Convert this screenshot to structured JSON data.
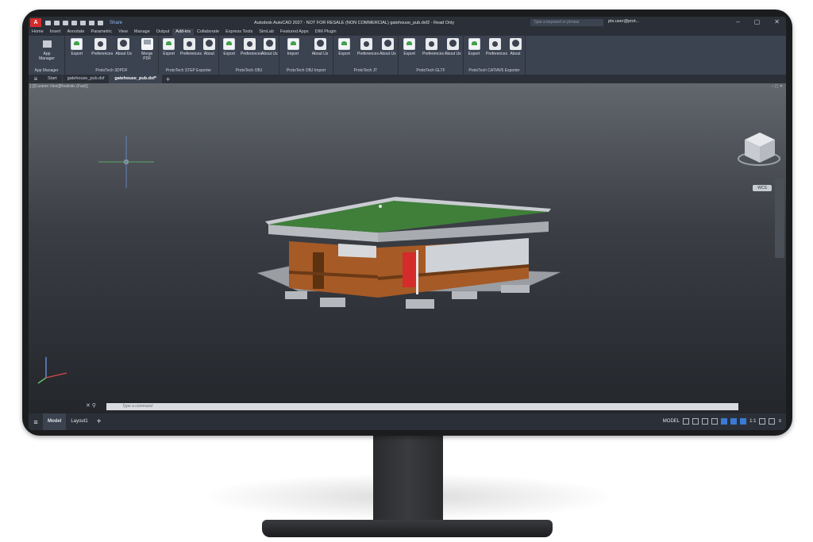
{
  "window": {
    "app_logo": "A",
    "share_label": "Share",
    "title": "Autodesk AutoCAD 2027 - NOT FOR RESALE (NON COMMERCIAL)   gatehouse_pub.dxf2 - Read Only",
    "search_placeholder": "Type a keyword or phrase",
    "user": "pts.user@prot...",
    "minimize": "–",
    "maximize": "▢",
    "close": "✕"
  },
  "menu": {
    "tabs": [
      "Home",
      "Insert",
      "Annotate",
      "Parametric",
      "View",
      "Manage",
      "Output",
      "Add-ins",
      "Collaborate",
      "Express Tools",
      "SimLab",
      "Featured Apps",
      "DIM Plugin"
    ],
    "active": "Add-ins"
  },
  "ribbon": {
    "panels": [
      {
        "name": "App Manager",
        "tools": [
          {
            "label": "App Manager",
            "icon": "app-manager-icon"
          }
        ]
      },
      {
        "name": "ProtoTech 3DPDF",
        "tools": [
          {
            "label": "Export",
            "icon": "export-icon"
          },
          {
            "label": "Preferences",
            "icon": "preferences-icon"
          },
          {
            "label": "About Us",
            "icon": "about-us-icon"
          },
          {
            "label": "Merge PDF",
            "icon": "merge-pdf-icon"
          }
        ]
      },
      {
        "name": "ProtoTech STEP Exporter",
        "tools": [
          {
            "label": "Export",
            "icon": "export-icon"
          },
          {
            "label": "Preferences",
            "icon": "preferences-icon"
          },
          {
            "label": "About",
            "icon": "about-icon"
          }
        ]
      },
      {
        "name": "ProtoTech OBJ",
        "tools": [
          {
            "label": "Export",
            "icon": "export-icon"
          },
          {
            "label": "Preferences",
            "icon": "preferences-icon"
          },
          {
            "label": "About Us",
            "icon": "about-us-icon"
          }
        ]
      },
      {
        "name": "ProtoTech OBJ Import",
        "tools": [
          {
            "label": "Import",
            "icon": "import-icon"
          },
          {
            "label": "About Us",
            "icon": "about-us-icon"
          }
        ]
      },
      {
        "name": "ProtoTech JT",
        "tools": [
          {
            "label": "Export",
            "icon": "export-icon"
          },
          {
            "label": "Preferences",
            "icon": "preferences-icon"
          },
          {
            "label": "About Us",
            "icon": "about-us-icon"
          }
        ]
      },
      {
        "name": "ProtoTech GLTF",
        "tools": [
          {
            "label": "Export",
            "icon": "export-icon"
          },
          {
            "label": "Preferences",
            "icon": "preferences-icon"
          },
          {
            "label": "About Us",
            "icon": "about-us-icon"
          }
        ]
      },
      {
        "name": "ProtoTech CATIAV5 Exporter",
        "tools": [
          {
            "label": "Export",
            "icon": "export-icon"
          },
          {
            "label": "Preferences",
            "icon": "preferences-icon"
          },
          {
            "label": "About",
            "icon": "about-icon"
          }
        ]
      }
    ]
  },
  "doc_tabs": {
    "start": "Start",
    "files": [
      "gatehouse_pub.dxf",
      "gatehouse_pub.dxf*"
    ],
    "active": "gatehouse_pub.dxf*"
  },
  "viewport": {
    "label": "[-][Custom View][Realistic (Fast)]",
    "viewcube_label": "WCS",
    "cmd_placeholder": "Type a command"
  },
  "status": {
    "tabs": [
      "Model",
      "Layout1"
    ],
    "active": "Model",
    "model_label": "MODEL",
    "scale": "1:1"
  },
  "colors": {
    "roof": "#3f7f3a",
    "wall": "#a65a26",
    "door_red": "#d42b2b",
    "accent_blue": "#3a7bd5"
  }
}
